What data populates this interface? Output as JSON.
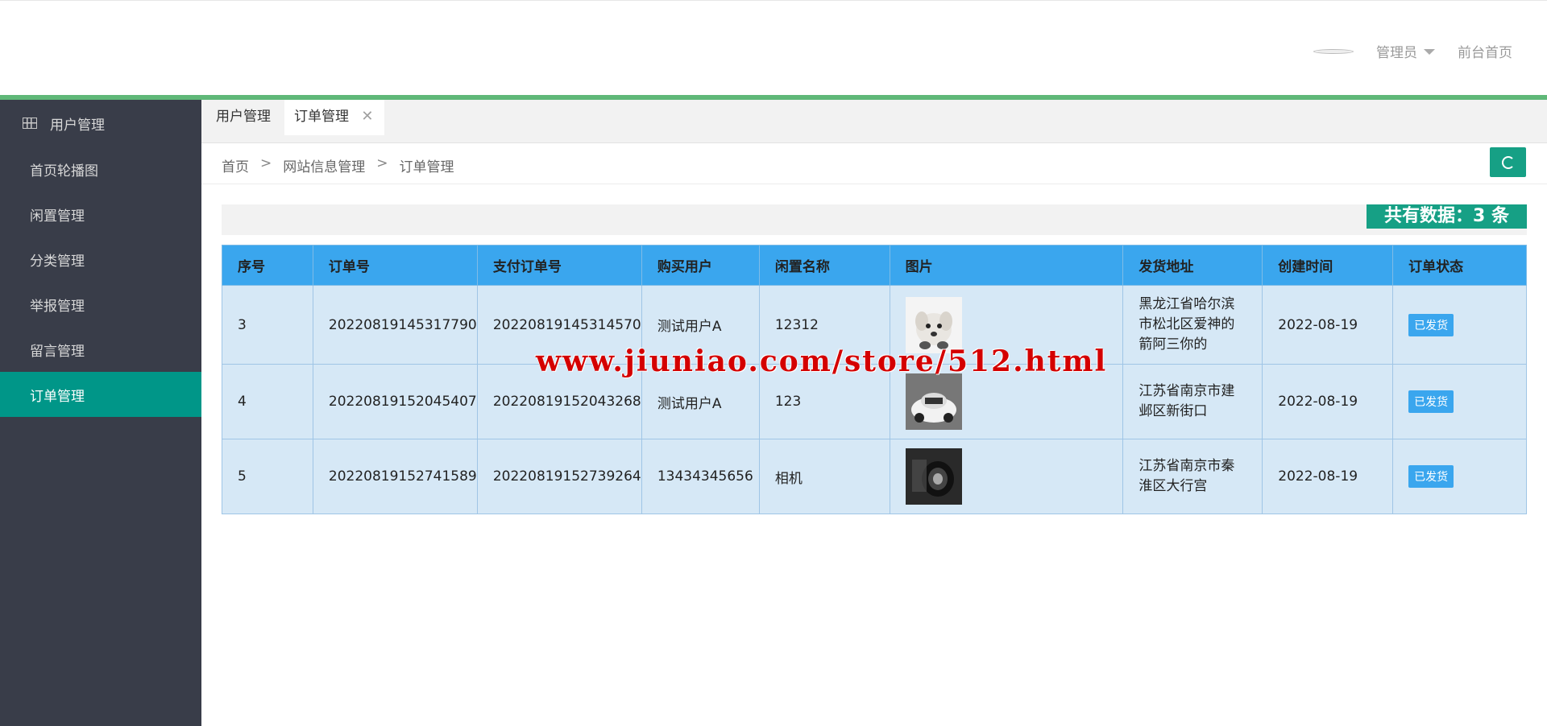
{
  "header": {
    "admin_label": "管理员",
    "frontpage_label": "前台首页"
  },
  "sidebar": {
    "head_label": "用户管理",
    "items": [
      {
        "label": "首页轮播图"
      },
      {
        "label": "闲置管理"
      },
      {
        "label": "分类管理"
      },
      {
        "label": "举报管理"
      },
      {
        "label": "留言管理"
      },
      {
        "label": "订单管理",
        "active": true
      }
    ]
  },
  "tabs": [
    {
      "label": "用户管理"
    },
    {
      "label": "订单管理",
      "close": "✕"
    }
  ],
  "breadcrumb": {
    "items": [
      "首页",
      "网站信息管理",
      "订单管理"
    ],
    "sep": ">"
  },
  "count_text": "共有数据：3 条",
  "table": {
    "headers": [
      "序号",
      "订单号",
      "支付订单号",
      "购买用户",
      "闲置名称",
      "图片",
      "发货地址",
      "创建时间",
      "订单状态"
    ],
    "rows": [
      {
        "id": "3",
        "order_no": "20220819145317790",
        "pay_no": "20220819145314570",
        "user": "测试用户A",
        "name": "12312",
        "image": "puppy-photo",
        "address": "黑龙江省哈尔滨市松北区爱神的箭阿三你的",
        "created": "2022-08-19",
        "status": "已发货"
      },
      {
        "id": "4",
        "order_no": "20220819152045407",
        "pay_no": "20220819152043268",
        "user": "测试用户A",
        "name": "123",
        "image": "car-photo",
        "address": "江苏省南京市建邺区新街口",
        "created": "2022-08-19",
        "status": "已发货"
      },
      {
        "id": "5",
        "order_no": "20220819152741589",
        "pay_no": "20220819152739264",
        "user": "13434345656",
        "name": "相机",
        "image": "camera-photo",
        "address": "江苏省南京市秦淮区大行宫",
        "created": "2022-08-19",
        "status": "已发货"
      }
    ]
  },
  "watermark": "www.jiuniao.com/store/512.html",
  "colors": {
    "sidebar_bg": "#393d49",
    "active": "#009688",
    "header_line": "#5fb878",
    "table_head": "#3aa6ee",
    "table_row": "#d6e8f6"
  }
}
